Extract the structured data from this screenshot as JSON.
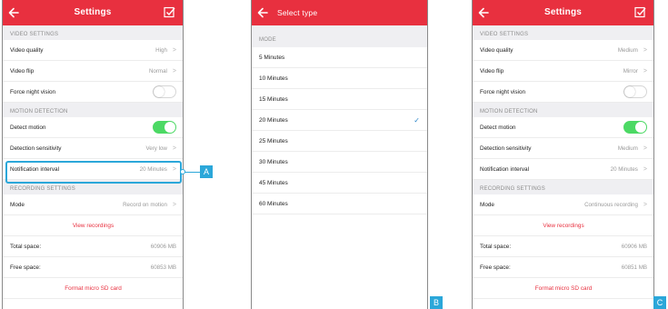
{
  "colors": {
    "accent": "#e8303f",
    "toggle_on": "#4cd964",
    "callout": "#2ba7d9",
    "tick": "#2b86c9"
  },
  "panel_a": {
    "title": "Settings",
    "sections": {
      "video": "VIDEO SETTINGS",
      "motion": "MOTION DETECTION",
      "recording": "RECORDING SETTINGS"
    },
    "video_quality": {
      "label": "Video quality",
      "value": "High"
    },
    "video_flip": {
      "label": "Video flip",
      "value": "Normal"
    },
    "force_night_vision": {
      "label": "Force night vision",
      "on": false
    },
    "detect_motion": {
      "label": "Detect motion",
      "on": true
    },
    "detection_sensitivity": {
      "label": "Detection sensitivity",
      "value": "Very low"
    },
    "notification_interval": {
      "label": "Notification interval",
      "value": "20 Minutes"
    },
    "mode": {
      "label": "Mode",
      "value": "Record on motion"
    },
    "view_recordings": "View recordings",
    "total_space": {
      "label": "Total space:",
      "value": "60906 MB"
    },
    "free_space": {
      "label": "Free space:",
      "value": "60853 MB"
    },
    "format_sd": "Format micro SD card"
  },
  "panel_b": {
    "title": "Select type",
    "section": "MODE",
    "options": [
      "5 Minutes",
      "10 Minutes",
      "15 Minutes",
      "20 Minutes",
      "25 Minutes",
      "30 Minutes",
      "45 Minutes",
      "60 Minutes"
    ],
    "selected": "20 Minutes"
  },
  "panel_c": {
    "title": "Settings",
    "sections": {
      "video": "VIDEO SETTINGS",
      "motion": "MOTION DETECTION",
      "recording": "RECORDING SETTINGS"
    },
    "video_quality": {
      "label": "Video quality",
      "value": "Medium"
    },
    "video_flip": {
      "label": "Video flip",
      "value": "Mirror"
    },
    "force_night_vision": {
      "label": "Force night vision",
      "on": false
    },
    "detect_motion": {
      "label": "Detect motion",
      "on": true
    },
    "detection_sensitivity": {
      "label": "Detection sensitivity",
      "value": "Medium"
    },
    "notification_interval": {
      "label": "Notification interval",
      "value": "20 Minutes"
    },
    "mode": {
      "label": "Mode",
      "value": "Continuous recording"
    },
    "view_recordings": "View recordings",
    "total_space": {
      "label": "Total space:",
      "value": "60906 MB"
    },
    "free_space": {
      "label": "Free space:",
      "value": "60851 MB"
    },
    "format_sd": "Format micro SD card"
  },
  "callouts": {
    "a": "A",
    "b": "B",
    "c": "C"
  }
}
